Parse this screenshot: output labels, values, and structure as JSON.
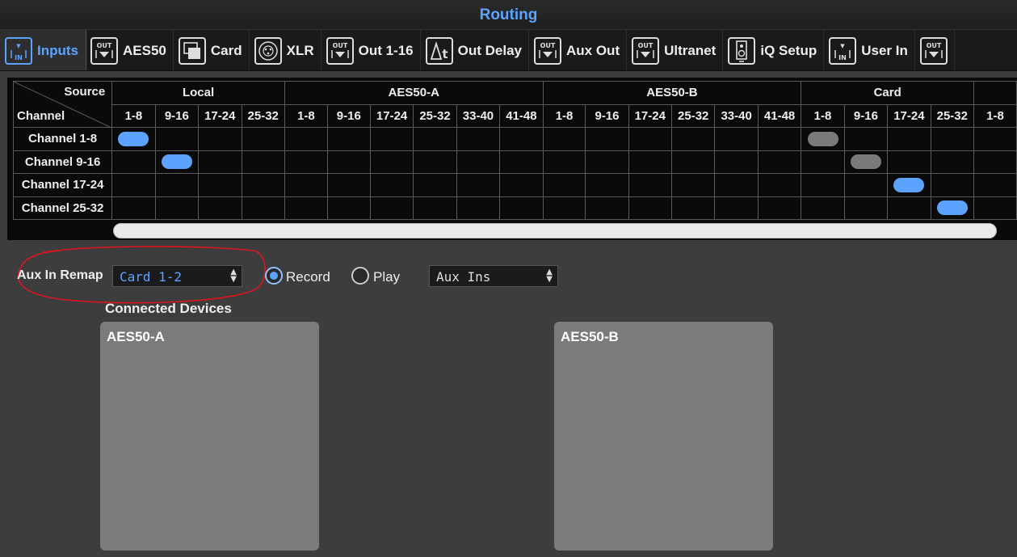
{
  "title": "Routing",
  "tabs": [
    {
      "label": "Inputs",
      "icon": "input-icon",
      "active": true
    },
    {
      "label": "AES50",
      "icon": "output-icon"
    },
    {
      "label": "Card",
      "icon": "card-icon"
    },
    {
      "label": "XLR",
      "icon": "xlr-icon"
    },
    {
      "label": "Out 1-16",
      "icon": "output-icon"
    },
    {
      "label": "Out Delay",
      "icon": "delta-t-icon"
    },
    {
      "label": "Aux Out",
      "icon": "output-icon"
    },
    {
      "label": "Ultranet",
      "icon": "output-icon"
    },
    {
      "label": "iQ Setup",
      "icon": "speaker-icon"
    },
    {
      "label": "User In",
      "icon": "input-icon"
    },
    {
      "label": "",
      "icon": "output-icon"
    }
  ],
  "matrix": {
    "corner_source": "Source",
    "corner_channel": "Channel",
    "groups": [
      {
        "label": "Local",
        "cols": [
          "1-8",
          "9-16",
          "17-24",
          "25-32"
        ]
      },
      {
        "label": "AES50-A",
        "cols": [
          "1-8",
          "9-16",
          "17-24",
          "25-32",
          "33-40",
          "41-48"
        ]
      },
      {
        "label": "AES50-B",
        "cols": [
          "1-8",
          "9-16",
          "17-24",
          "25-32",
          "33-40",
          "41-48"
        ]
      },
      {
        "label": "Card",
        "cols": [
          "1-8",
          "9-16",
          "17-24",
          "25-32"
        ]
      },
      {
        "label": "",
        "cols": [
          "1-8"
        ]
      }
    ],
    "rows": [
      {
        "label": "Channel 1-8",
        "cells": {
          "0": "blue",
          "16": "grey"
        }
      },
      {
        "label": "Channel 9-16",
        "cells": {
          "1": "blue",
          "17": "grey"
        }
      },
      {
        "label": "Channel 17-24",
        "cells": {
          "18": "blue"
        }
      },
      {
        "label": "Channel 25-32",
        "cells": {
          "19": "blue"
        }
      }
    ]
  },
  "aux_remap": {
    "label": "Aux In Remap",
    "value": "Card 1-2",
    "record_label": "Record",
    "play_label": "Play",
    "mode": "record",
    "aux_select": "Aux Ins"
  },
  "connected": {
    "title": "Connected Devices",
    "devices": [
      "AES50-A",
      "AES50-B"
    ]
  },
  "colors": {
    "accent": "#5ba3ff",
    "annotation": "#e0141e",
    "inactive_route": "#7a7a7a"
  }
}
